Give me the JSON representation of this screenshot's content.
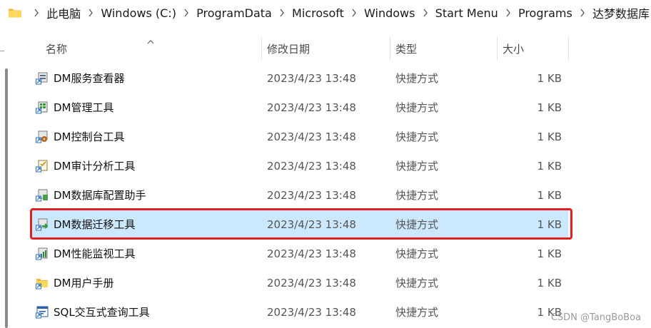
{
  "breadcrumb": {
    "items": [
      "此电脑",
      "Windows (C:)",
      "ProgramData",
      "Microsoft",
      "Windows",
      "Start Menu",
      "Programs",
      "达梦数据库"
    ]
  },
  "columns": {
    "name": "名称",
    "modified": "修改日期",
    "type": "类型",
    "size": "大小"
  },
  "files": [
    {
      "name": "DM服务查看器",
      "modified": "2023/4/23 13:48",
      "type": "快捷方式",
      "size": "1 KB",
      "icon": "service-viewer-shortcut-icon"
    },
    {
      "name": "DM管理工具",
      "modified": "2023/4/23 13:48",
      "type": "快捷方式",
      "size": "1 KB",
      "icon": "manager-shortcut-icon"
    },
    {
      "name": "DM控制台工具",
      "modified": "2023/4/23 13:48",
      "type": "快捷方式",
      "size": "1 KB",
      "icon": "console-shortcut-icon"
    },
    {
      "name": "DM审计分析工具",
      "modified": "2023/4/23 13:48",
      "type": "快捷方式",
      "size": "1 KB",
      "icon": "audit-shortcut-icon"
    },
    {
      "name": "DM数据库配置助手",
      "modified": "2023/4/23 13:48",
      "type": "快捷方式",
      "size": "1 KB",
      "icon": "config-assistant-shortcut-icon"
    },
    {
      "name": "DM数据迁移工具",
      "modified": "2023/4/23 13:48",
      "type": "快捷方式",
      "size": "1 KB",
      "icon": "migration-shortcut-icon",
      "selected": true
    },
    {
      "name": "DM性能监视工具",
      "modified": "2023/4/23 13:48",
      "type": "快捷方式",
      "size": "1 KB",
      "icon": "performance-monitor-shortcut-icon"
    },
    {
      "name": "DM用户手册",
      "modified": "2023/4/23 13:48",
      "type": "快捷方式",
      "size": "1 KB",
      "icon": "folder-shortcut-icon"
    },
    {
      "name": "SQL交互式查询工具",
      "modified": "2023/4/23 13:48",
      "type": "快捷方式",
      "size": "1 KB",
      "icon": "sql-query-shortcut-icon"
    }
  ],
  "colors": {
    "selection": "#cce8ff",
    "highlight_border": "#e02020",
    "folder": "#f5c542"
  },
  "watermark": "CSDN @TangBoBoa"
}
